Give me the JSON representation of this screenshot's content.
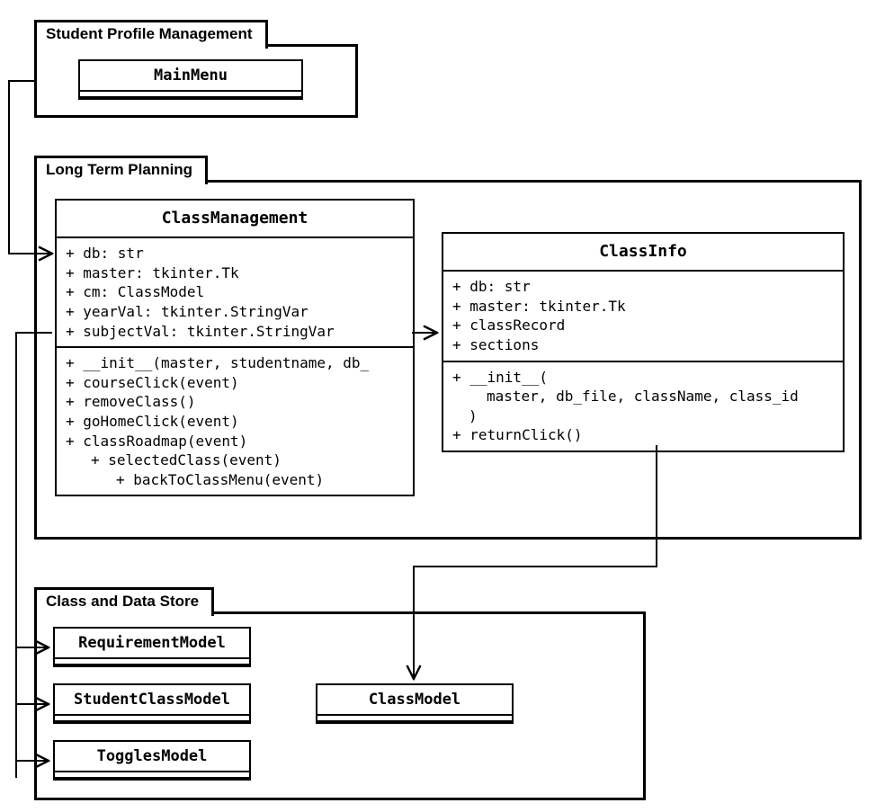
{
  "packages": {
    "spm": {
      "title": "Student Profile Management"
    },
    "ltp": {
      "title": "Long Term Planning"
    },
    "cds": {
      "title": "Class and Data Store"
    }
  },
  "mini_classes": {
    "mainMenu": {
      "name": "MainMenu"
    },
    "requirementModel": {
      "name": "RequirementModel"
    },
    "studentClassModel": {
      "name": "StudentClassModel"
    },
    "togglesModel": {
      "name": "TogglesModel"
    },
    "classModel": {
      "name": "ClassModel"
    }
  },
  "classes": {
    "classManagement": {
      "name": "ClassManagement",
      "fields": [
        "+ db: str",
        "+ master: tkinter.Tk",
        "+ cm: ClassModel",
        "+ yearVal: tkinter.StringVar",
        "+ subjectVal: tkinter.StringVar"
      ],
      "methods": [
        {
          "text": "+ __init__(master, studentname, db_",
          "indent": 0
        },
        {
          "text": "+ courseClick(event)",
          "indent": 0
        },
        {
          "text": "+ removeClass()",
          "indent": 0
        },
        {
          "text": "+ goHomeClick(event)",
          "indent": 0
        },
        {
          "text": "+ classRoadmap(event)",
          "indent": 0
        },
        {
          "text": "+ selectedClass(event)",
          "indent": 1
        },
        {
          "text": "+ backToClassMenu(event)",
          "indent": 2
        }
      ]
    },
    "classInfo": {
      "name": "ClassInfo",
      "fields": [
        "+ db: str",
        "+ master: tkinter.Tk",
        "+ classRecord",
        "+ sections"
      ],
      "methods": [
        {
          "text": "+ __init__(",
          "indent": 0
        },
        {
          "text": "master, db_file, className, class_id",
          "indent": 1,
          "noPlus": true
        },
        {
          "text": ")",
          "indent": 1,
          "noPlus": true,
          "closeParen": true
        },
        {
          "text": "+ returnClick()",
          "indent": 0
        }
      ]
    }
  }
}
